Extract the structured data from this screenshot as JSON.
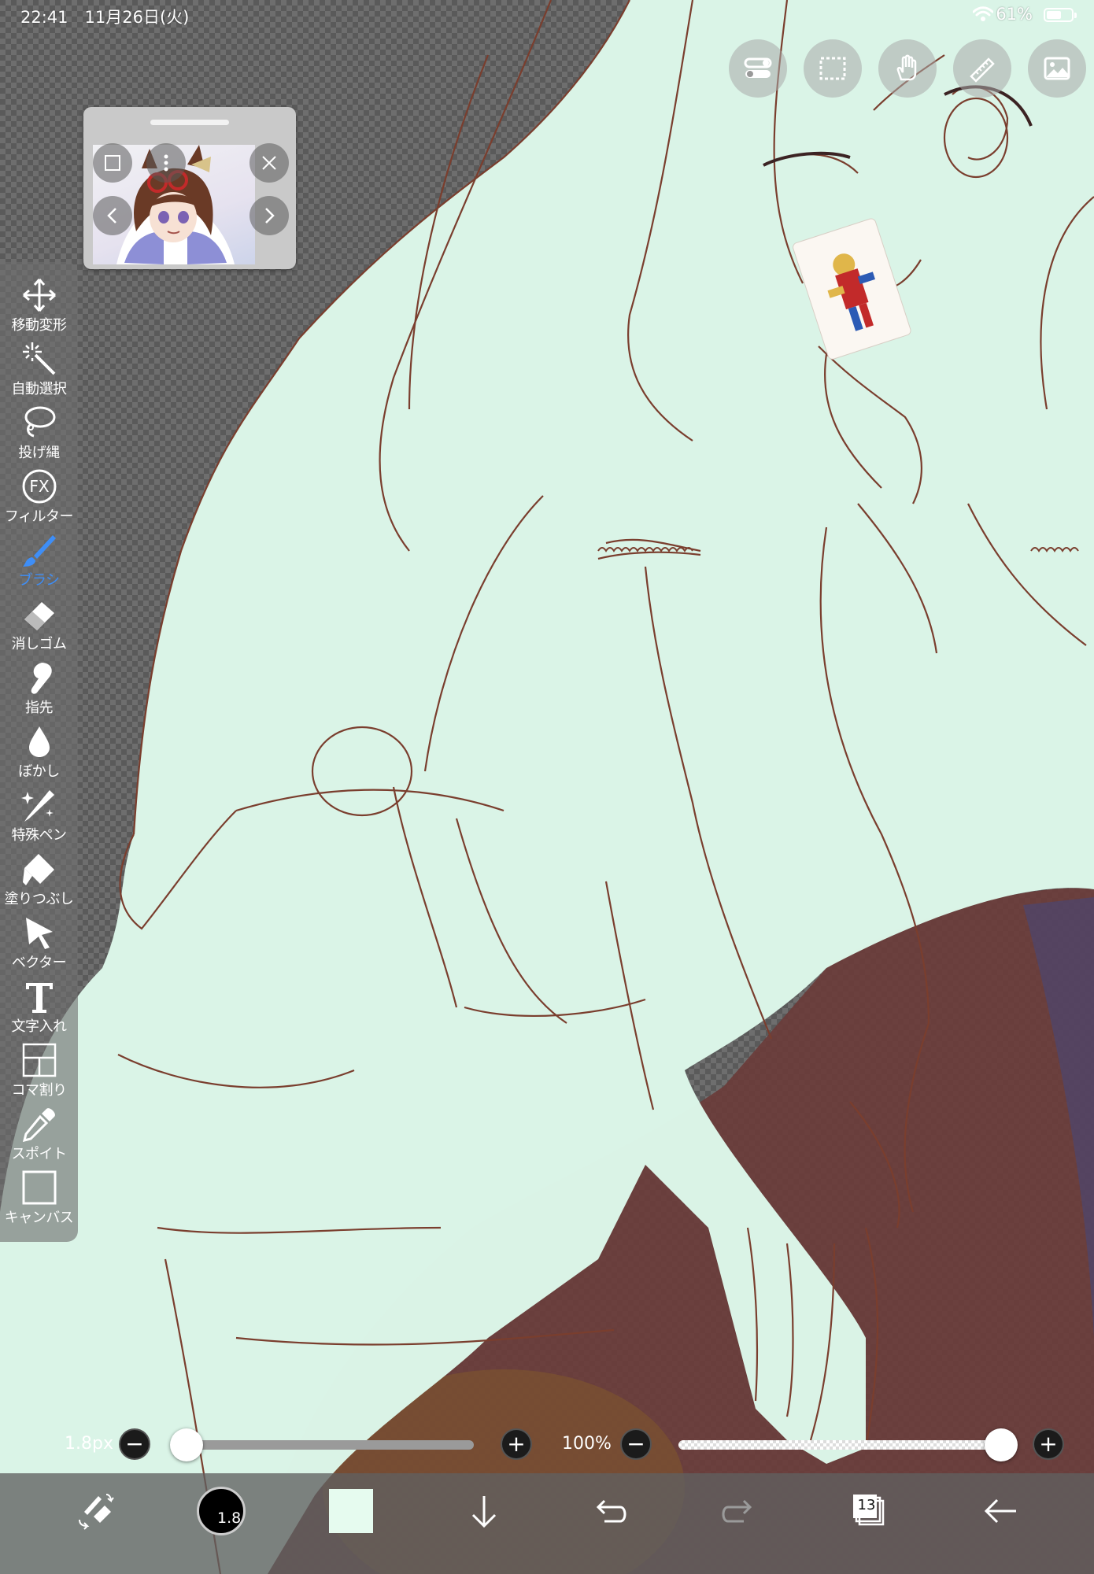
{
  "status_bar": {
    "time": "22:41　11月26日(火)",
    "battery_text": "61%",
    "battery_level": 0.61
  },
  "top_tools": [
    {
      "icon": "toggle-switches-icon"
    },
    {
      "icon": "dotted-rect-icon"
    },
    {
      "icon": "hand-icon"
    },
    {
      "icon": "ruler-icon"
    },
    {
      "icon": "image-icon"
    }
  ],
  "reference_window": {
    "icons": [
      "reference-icon",
      "more-icon",
      "close-icon",
      "prev-icon",
      "next-icon"
    ]
  },
  "toolbar": {
    "tools": [
      {
        "label": "移動変形",
        "icon": "move-transform-icon"
      },
      {
        "label": "自動選択",
        "icon": "magic-wand-icon"
      },
      {
        "label": "投げ縄",
        "icon": "lasso-icon"
      },
      {
        "label": "フィルター",
        "icon": "fx-icon"
      },
      {
        "label": "ブラシ",
        "icon": "brush-icon",
        "active": true
      },
      {
        "label": "消しゴム",
        "icon": "eraser-icon"
      },
      {
        "label": "指先",
        "icon": "smudge-icon"
      },
      {
        "label": "ぼかし",
        "icon": "blur-drop-icon"
      },
      {
        "label": "特殊ペン",
        "icon": "special-pen-icon"
      },
      {
        "label": "塗りつぶし",
        "icon": "fill-bucket-icon"
      },
      {
        "label": "ベクター",
        "icon": "vector-cursor-icon"
      },
      {
        "label": "文字入れ",
        "icon": "text-icon"
      },
      {
        "label": "コマ割り",
        "icon": "panel-split-icon"
      },
      {
        "label": "スポイト",
        "icon": "eyedropper-icon"
      },
      {
        "label": "キャンバス",
        "icon": "canvas-icon"
      }
    ]
  },
  "brush_size": {
    "label": "1.8px",
    "value_fraction": 0.0
  },
  "brush_opacity": {
    "label": "100%",
    "value_fraction": 1.0
  },
  "bottom_bar": {
    "brush_preview_size": "1.8",
    "current_color": "#e6fbef",
    "layers_count": "13"
  },
  "colors": {
    "accent": "#3e8ef7",
    "canvas_fill": "#dcf7ea",
    "lineart": "#7a3e2e",
    "chair": "#6d3836"
  }
}
